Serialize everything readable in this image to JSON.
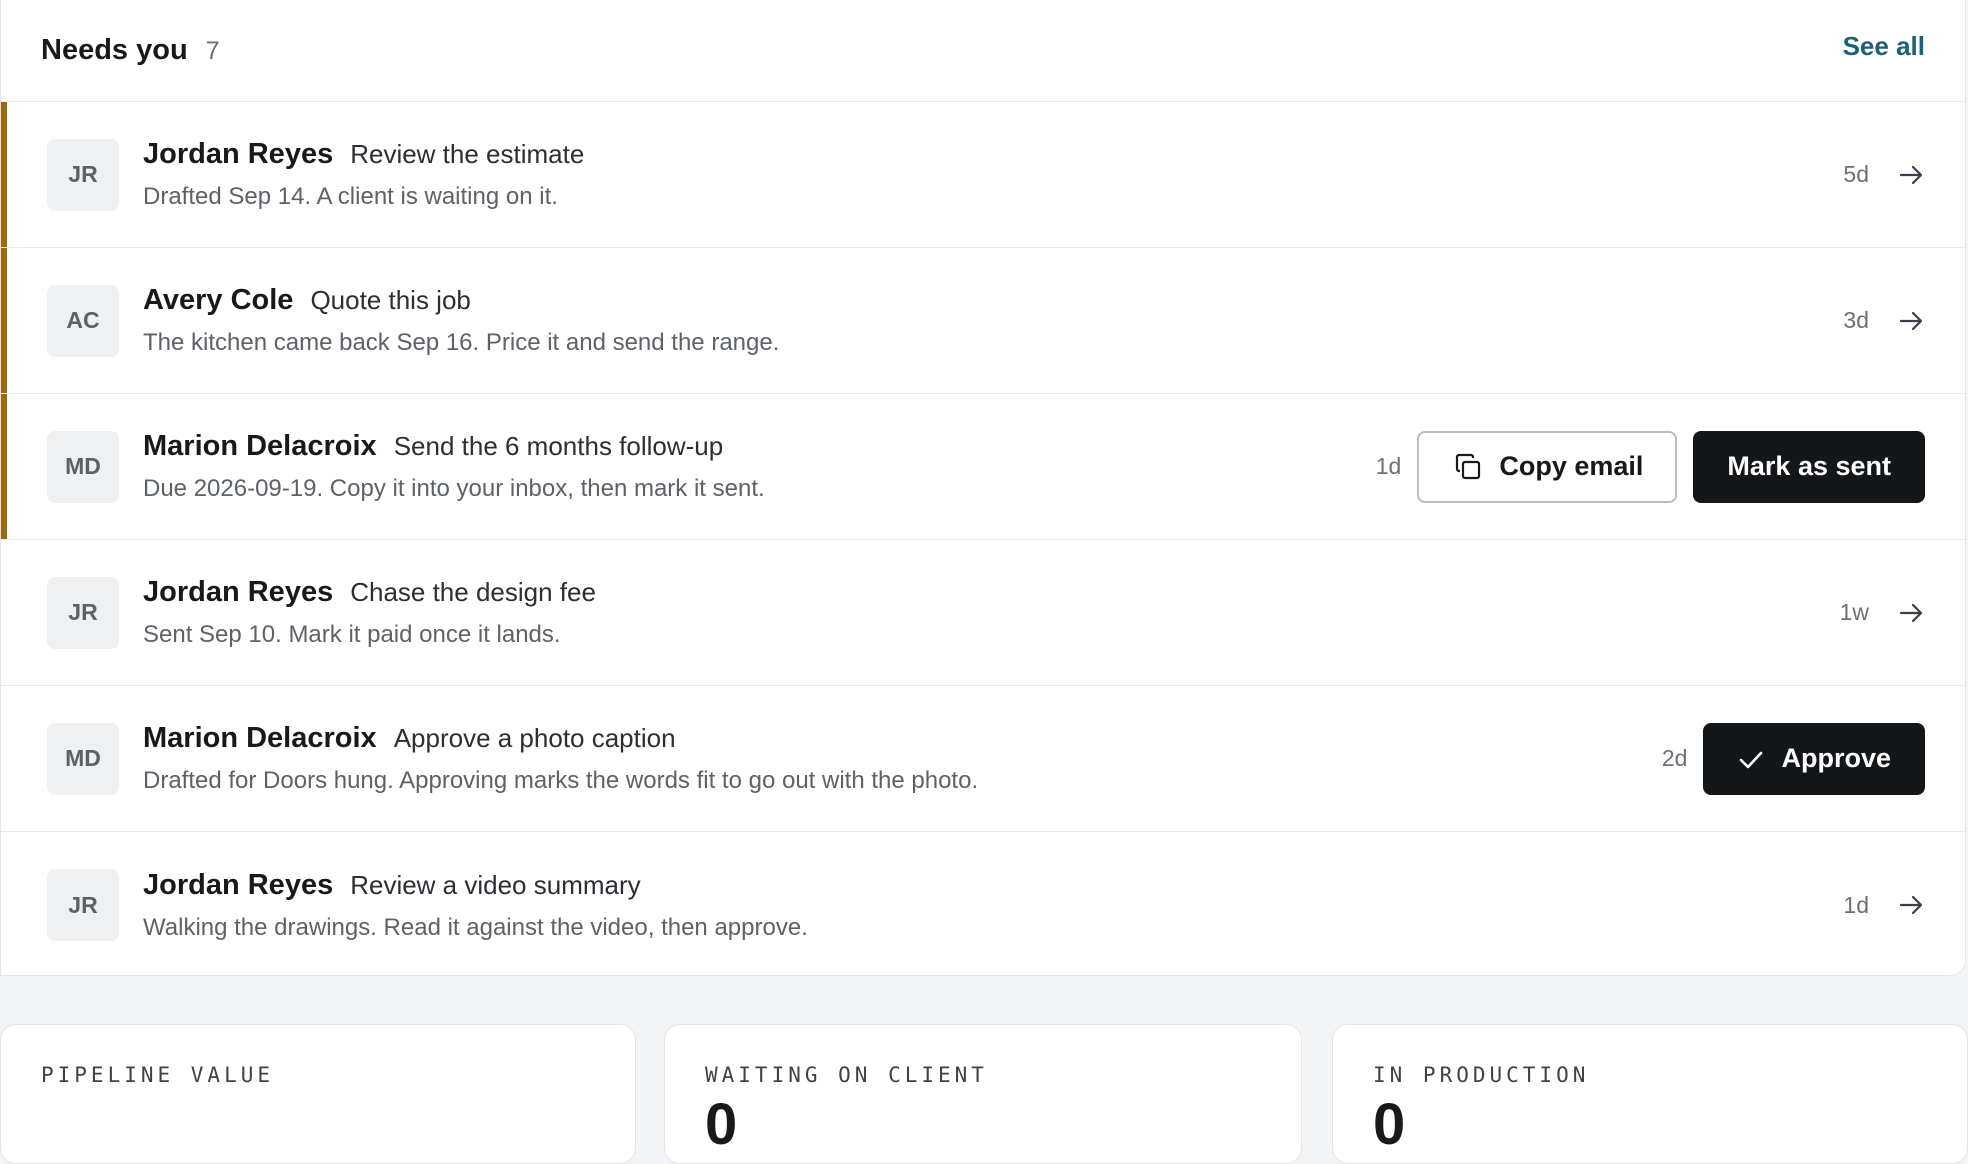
{
  "header": {
    "title": "Needs you",
    "count": "7",
    "see_all": "See all"
  },
  "rows": [
    {
      "initials": "JR",
      "name": "Jordan Reyes",
      "task": "Review the estimate",
      "detail": "Drafted Sep 14. A client is waiting on it.",
      "age": "5d",
      "flagged": true
    },
    {
      "initials": "AC",
      "name": "Avery Cole",
      "task": "Quote this job",
      "detail": "The kitchen came back Sep 16. Price it and send the range.",
      "age": "3d",
      "flagged": true
    },
    {
      "initials": "MD",
      "name": "Marion Delacroix",
      "task": "Send the 6 months follow-up",
      "detail": "Due 2026-09-19. Copy it into your inbox, then mark it sent.",
      "age": "1d",
      "flagged": true,
      "actions": {
        "copy": "Copy email",
        "mark_sent": "Mark as sent"
      }
    },
    {
      "initials": "JR",
      "name": "Jordan Reyes",
      "task": "Chase the design fee",
      "detail": "Sent Sep 10. Mark it paid once it lands.",
      "age": "1w",
      "flagged": false
    },
    {
      "initials": "MD",
      "name": "Marion Delacroix",
      "task": "Approve a photo caption",
      "detail": "Drafted for Doors hung. Approving marks the words fit to go out with the photo.",
      "age": "2d",
      "flagged": false,
      "actions": {
        "approve": "Approve"
      }
    },
    {
      "initials": "JR",
      "name": "Jordan Reyes",
      "task": "Review a video summary",
      "detail": "Walking the drawings. Read it against the video, then approve.",
      "age": "1d",
      "flagged": false
    }
  ],
  "stats": [
    {
      "label": "PIPELINE VALUE",
      "value": ""
    },
    {
      "label": "WAITING ON CLIENT",
      "value": "0"
    },
    {
      "label": "IN PRODUCTION",
      "value": "0"
    }
  ],
  "colors": {
    "accent_flag": "#9c6c0c",
    "link": "#1d6176",
    "primary_button": "#14171a"
  },
  "icons": {
    "row_open": "arrow-right-icon",
    "copy": "copy-icon",
    "approve": "check-icon"
  }
}
